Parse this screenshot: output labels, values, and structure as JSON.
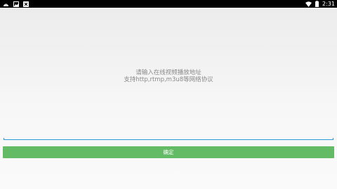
{
  "status_bar": {
    "left_icons": [
      "android-notification-icon",
      "image-notification-icon",
      "close-box-notification-icon"
    ],
    "right_icons": [
      "wifi-icon",
      "battery-icon"
    ],
    "time": "2:31"
  },
  "main": {
    "prompt_line1": "请输入在线视频播放地址",
    "prompt_line2": "支持http,rtmp,m3u8等网络协议",
    "url_input_value": "",
    "confirm_label": "确定"
  },
  "colors": {
    "accent": "#2a9bd6",
    "button": "#63bb66",
    "status_bar": "#000000"
  }
}
